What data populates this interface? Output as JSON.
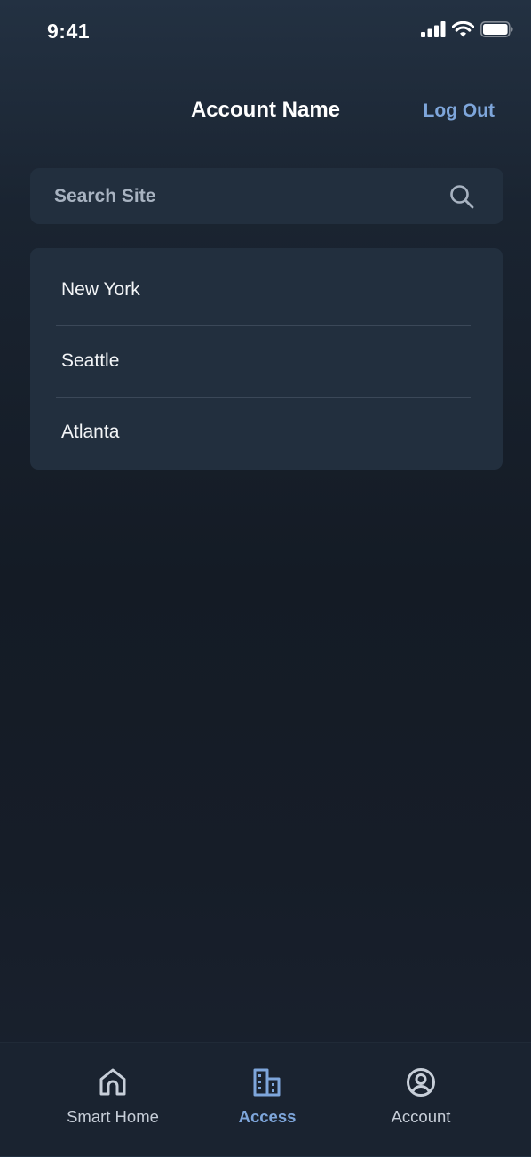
{
  "status_bar": {
    "time": "9:41"
  },
  "header": {
    "title": "Account Name",
    "logout_label": "Log Out"
  },
  "search": {
    "placeholder": "Search Site",
    "value": ""
  },
  "sites": [
    {
      "label": "New York"
    },
    {
      "label": "Seattle"
    },
    {
      "label": "Atlanta"
    }
  ],
  "tab_bar": {
    "tabs": [
      {
        "label": "Smart Home",
        "icon": "home-icon",
        "active": false
      },
      {
        "label": "Access",
        "icon": "building-icon",
        "active": true
      },
      {
        "label": "Account",
        "icon": "account-circle-icon",
        "active": false
      }
    ]
  },
  "colors": {
    "accent": "#7ea6db",
    "card": "#222f3e",
    "background": "#141b25"
  }
}
